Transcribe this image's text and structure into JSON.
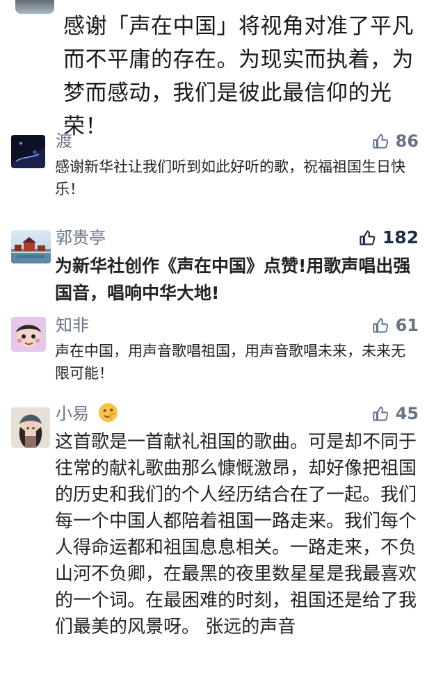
{
  "feed": {
    "quote": "感谢「声在中国」将视角对准了平凡而不平庸的存在。为现实而执着，为梦而感动，我们是彼此最信仰的光荣！"
  },
  "comments": [
    {
      "username": "渡",
      "likes": "86",
      "text": "感谢新华社让我们听到如此好听的歌，祝福祖国生日快乐！"
    },
    {
      "username": "郭贵亭",
      "likes": "182",
      "text": "为新华社创作《声在中国》点赞!用歌声唱出强国音，唱响中华大地!"
    },
    {
      "username": "知非",
      "likes": "61",
      "text": "声在中国，用声音歌唱祖国，用声音歌唱未来，未来无限可能！"
    },
    {
      "username": "小易",
      "likes": "45",
      "text": "这首歌是一首献礼祖国的歌曲。可是却不同于往常的献礼歌曲那么慷慨激昂，却好像把祖国的历史和我们的个人经历结合在了一起。我们每一个中国人都陪着祖国一路走来。我们每个人得命运都和祖国息息相关。一路走来，不负山河不负卿，在最黑的夜里数星星是我最喜欢的一个词。在最困难的时刻，祖国还是给了我们最美的风景呀。 张远的声音"
    }
  ],
  "icons": {
    "like": "thumbs-up-icon",
    "emoji": "thinking-face-icon"
  },
  "colors": {
    "username": "#687386",
    "text": "#222222",
    "like": "#687386"
  }
}
